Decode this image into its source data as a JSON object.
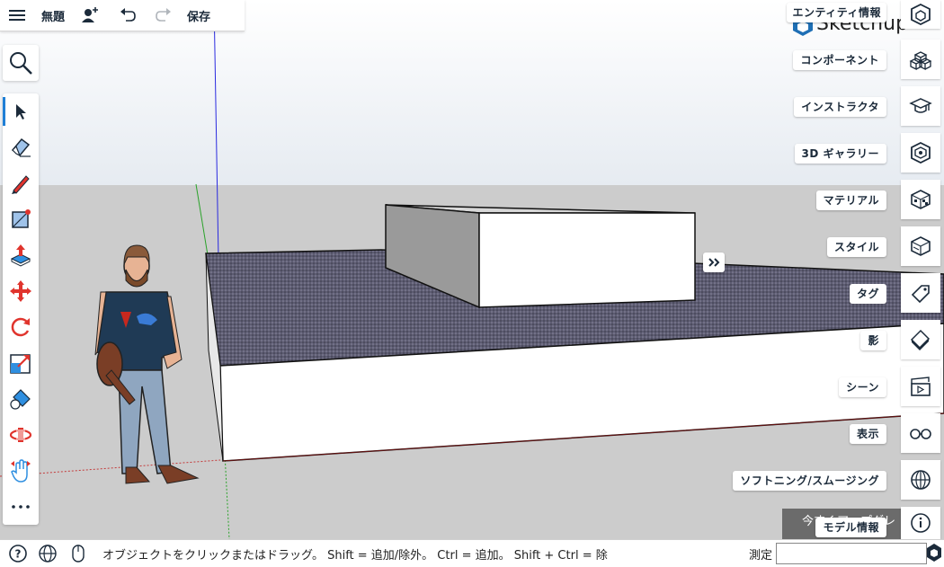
{
  "topbar": {
    "title": "無題",
    "save_label": "保存",
    "icons": [
      "menu-icon",
      "add-user-icon",
      "undo-icon",
      "redo-icon"
    ]
  },
  "left_tools": [
    {
      "name": "search-tool",
      "icon": "magnifier-icon"
    },
    {
      "name": "select-tool",
      "icon": "arrow-icon",
      "active": true
    },
    {
      "name": "eraser-tool",
      "icon": "eraser-icon"
    },
    {
      "name": "pencil-tool",
      "icon": "pencil-icon"
    },
    {
      "name": "rectangle-tool",
      "icon": "rectangle-icon"
    },
    {
      "name": "push-pull-tool",
      "icon": "push-pull-icon"
    },
    {
      "name": "move-tool",
      "icon": "move-icon"
    },
    {
      "name": "rotate-tool",
      "icon": "rotate-icon"
    },
    {
      "name": "scale-tool",
      "icon": "scale-icon"
    },
    {
      "name": "paint-tool",
      "icon": "paint-bucket-icon"
    },
    {
      "name": "orbit-tool",
      "icon": "orbit-icon"
    },
    {
      "name": "pan-tool",
      "icon": "hand-icon"
    },
    {
      "name": "more-tool",
      "icon": "more-icon"
    }
  ],
  "right_panel": {
    "entity_info": "エンティティ情報",
    "items": [
      {
        "label": "コンポーネント",
        "icon": "components-icon"
      },
      {
        "label": "インストラクタ",
        "icon": "instructor-icon"
      },
      {
        "label": "3D ギャラリー",
        "icon": "3d-warehouse-icon"
      },
      {
        "label": "マテリアル",
        "icon": "materials-icon"
      },
      {
        "label": "スタイル",
        "icon": "styles-icon"
      },
      {
        "label": "タグ",
        "icon": "tag-icon"
      },
      {
        "label": "影",
        "icon": "shadows-icon"
      },
      {
        "label": "シーン",
        "icon": "scenes-icon"
      },
      {
        "label": "表示",
        "icon": "display-icon"
      },
      {
        "label": "ソフトニング/スムージング",
        "icon": "soften-icon"
      },
      {
        "label": "モデル情報",
        "icon": "info-icon"
      }
    ],
    "logo_text": "Sketchup"
  },
  "promo_text": "今すぐアップグレ",
  "statusbar": {
    "hint": "オブジェクトをクリックまたはドラッグ。 Shift = 追加/除外。 Ctrl = 追加。 Shift + Ctrl = 除",
    "measure_label": "測定",
    "measure_value": ""
  },
  "colors": {
    "accent": "#1f7fd6",
    "tool_red": "#e0342d",
    "tool_blue": "#1f7fd6",
    "navy": "#1b2a3a"
  }
}
